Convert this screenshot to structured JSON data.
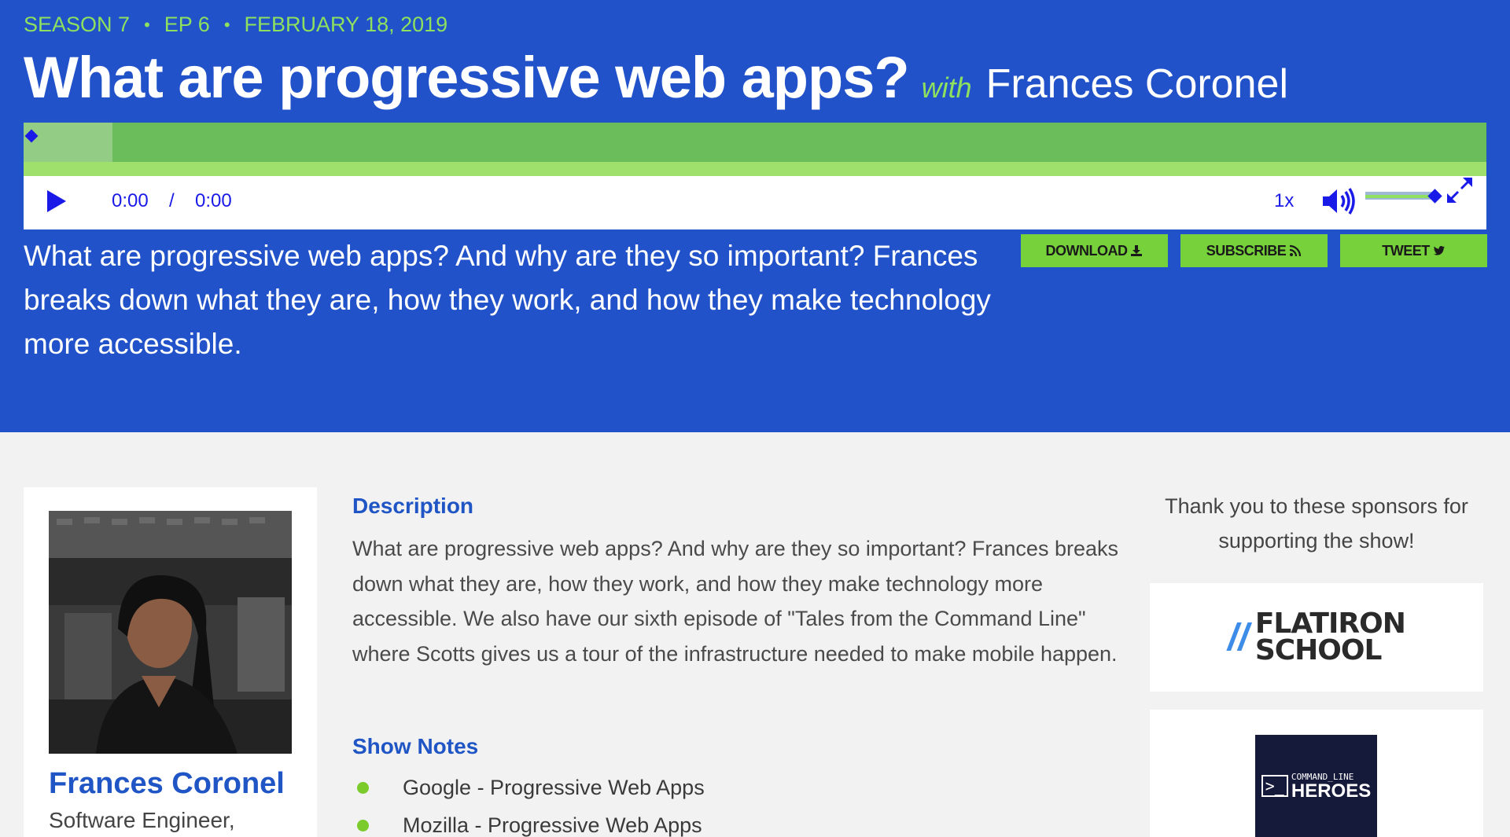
{
  "episode": {
    "season": "SEASON 7",
    "ep": "EP 6",
    "date": "FEBRUARY 18, 2019",
    "title": "What are progressive web apps?",
    "with_label": "with",
    "guest": "Frances Coronel",
    "summary": "What are progressive web apps? And why are they so important? Frances breaks down what they are, how they work, and how they make technology more accessible."
  },
  "player": {
    "current_time": "0:00",
    "separator": "/",
    "duration": "0:00",
    "rate": "1x",
    "progress": 0.0,
    "volume": 1.0,
    "icons": [
      "play-icon",
      "volume-icon",
      "fullscreen-icon"
    ]
  },
  "actions": {
    "download": "DOWNLOAD",
    "subscribe": "SUBSCRIBE",
    "tweet": "TWEET"
  },
  "guest_card": {
    "name": "Frances Coronel",
    "role": "Software Engineer,"
  },
  "content": {
    "description_heading": "Description",
    "description": "What are progressive web apps? And why are they so important? Frances breaks down what they are, how they work, and how they make technology more accessible. We also have our sixth episode of \"Tales from the Command Line\" where Scotts gives us a tour of the infrastructure needed to make mobile happen.",
    "notes_heading": "Show Notes",
    "notes": [
      "Google - Progressive Web Apps",
      "Mozilla - Progressive Web Apps"
    ]
  },
  "sponsors": {
    "thanks": "Thank you to these sponsors for supporting the show!",
    "flatiron_slash": "//",
    "flatiron_line1": "FLATIRON",
    "flatiron_line2": "SCHOOL",
    "clh_small": "COMMAND_LINE",
    "clh_big": "HEROES",
    "clh_prompt": ">_"
  },
  "colors": {
    "hero_bg": "#2152c9",
    "accent_green": "#8ee05e",
    "button_green": "#76d13a",
    "heading_blue": "#1f55c4",
    "player_blue": "#1a1ae8"
  }
}
